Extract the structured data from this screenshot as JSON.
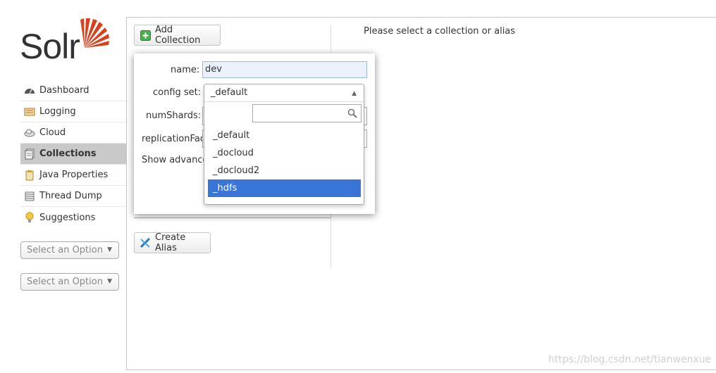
{
  "logo": {
    "text": "Solr"
  },
  "sidebar": {
    "items": [
      {
        "label": "Dashboard",
        "icon": "dashboard-icon",
        "active": false
      },
      {
        "label": "Logging",
        "icon": "logging-icon",
        "active": false
      },
      {
        "label": "Cloud",
        "icon": "cloud-icon",
        "active": false
      },
      {
        "label": "Collections",
        "icon": "collections-icon",
        "active": true
      },
      {
        "label": "Java Properties",
        "icon": "java-properties-icon",
        "active": false
      },
      {
        "label": "Thread Dump",
        "icon": "thread-dump-icon",
        "active": false
      },
      {
        "label": "Suggestions",
        "icon": "lightbulb-icon",
        "active": false
      }
    ],
    "core_selector_1": "Select an Option",
    "core_selector_2": "Select an Option"
  },
  "actions": {
    "add_collection": "Add Collection",
    "create_alias": "Create Alias"
  },
  "main": {
    "message": "Please select a collection or alias"
  },
  "add_form": {
    "name_label": "name:",
    "name_value": "dev",
    "config_set_label": "config set:",
    "config_set_value": "_default",
    "num_shards_label": "numShards:",
    "replication_label": "replicationFact",
    "advanced_label": "Show advance"
  },
  "dropdown": {
    "search_value": "",
    "options": [
      "_default",
      "_docloud",
      "_docloud2",
      "_hdfs"
    ],
    "highlighted": "_hdfs"
  },
  "watermark": "https://blog.csdn.net/tianwenxue",
  "colors": {
    "accent_red": "#d9411e",
    "highlight_blue": "#3875d7",
    "active_menu": "#c9c9c9"
  }
}
